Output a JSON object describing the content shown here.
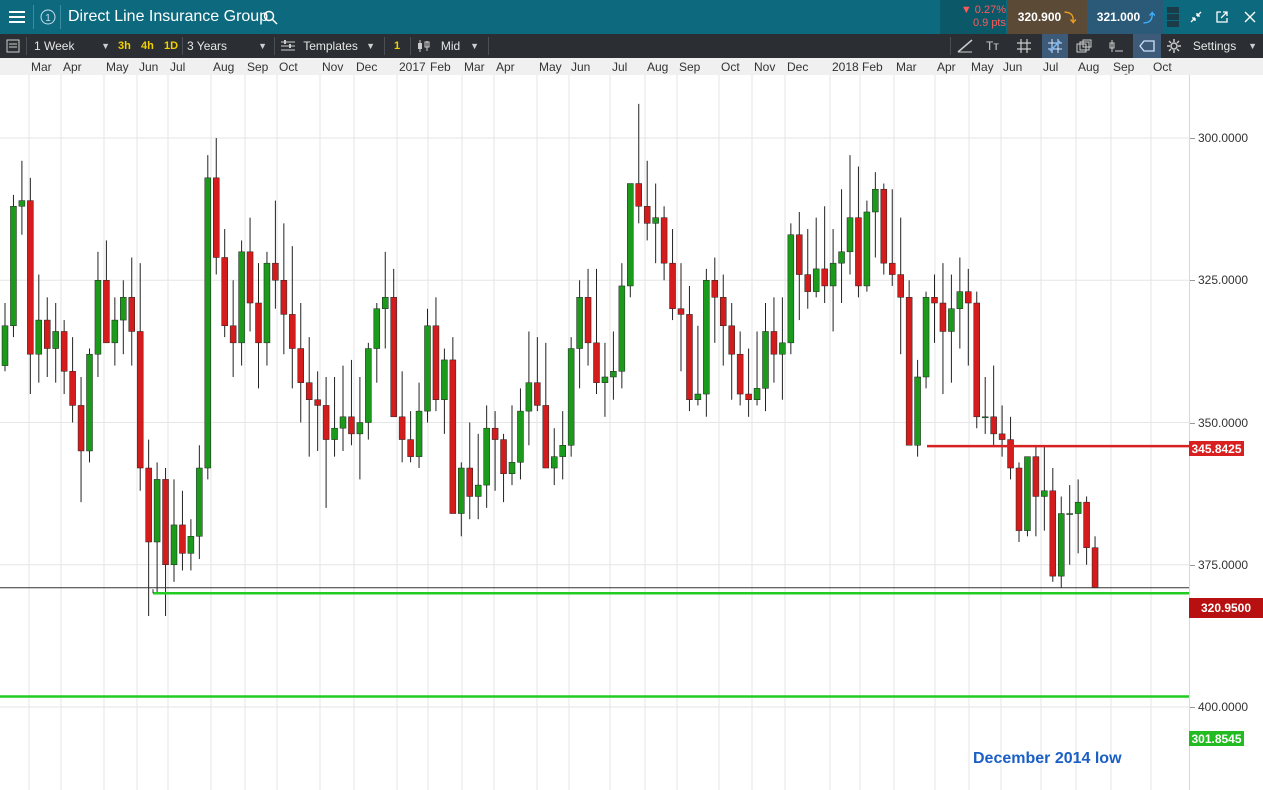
{
  "header": {
    "title": "Direct Line Insurance Group",
    "change_pct": "0.27%",
    "change_pts": "0.9 pts",
    "sell_price": "320.900",
    "buy_price": "321.000"
  },
  "toolbar": {
    "interval": "1 Week",
    "quick_3h": "3h",
    "quick_4h": "4h",
    "quick_1d": "1D",
    "range": "3 Years",
    "templates": "Templates",
    "count": "1",
    "price_type": "Mid",
    "settings": "Settings"
  },
  "colors": {
    "up": "#1b9a1b",
    "down": "#d41c1c",
    "header": "#0d6a7e",
    "toolbar": "#2b2f33",
    "support": "#22cc22",
    "resistance": "#d82020",
    "annotation": "#1a5fc4"
  },
  "axis": {
    "months": [
      "Mar",
      "Apr",
      "May",
      "Jun",
      "Jul",
      "Aug",
      "Sep",
      "Oct",
      "Nov",
      "Dec",
      "2017",
      "Feb",
      "Mar",
      "Apr",
      "May",
      "Jun",
      "Jul",
      "Aug",
      "Sep",
      "Oct",
      "Nov",
      "Dec",
      "2018",
      "Feb",
      "Mar",
      "Apr",
      "May",
      "Jun",
      "Jul",
      "Aug",
      "Sep",
      "Oct"
    ],
    "yticks": [
      "400.0000",
      "375.0000",
      "350.0000",
      "325.0000",
      "300.0000"
    ]
  },
  "levels": {
    "resistance": "345.8425",
    "current": "320.9500",
    "support": "301.8545"
  },
  "annotation": "December 2014 low",
  "chart_data": {
    "type": "candlestick",
    "interval": "1 Week",
    "range": "3 Years",
    "ylim": [
      298,
      412
    ],
    "yticks": [
      300,
      325,
      350,
      375,
      400
    ],
    "horizontal_lines": [
      {
        "value": 345.8425,
        "color": "#d82020",
        "label": "345.8425"
      },
      {
        "value": 320.95,
        "color": "#d41c1c",
        "label": "320.9500"
      },
      {
        "value": 320.0,
        "color": "#22cc22"
      },
      {
        "value": 301.8545,
        "color": "#22cc22",
        "label": "301.8545"
      }
    ],
    "ohlc": [
      [
        360,
        371,
        359,
        367
      ],
      [
        367,
        390,
        365,
        388
      ],
      [
        388,
        396,
        383,
        389
      ],
      [
        389,
        393,
        355,
        362
      ],
      [
        362,
        376,
        357,
        368
      ],
      [
        368,
        372,
        358,
        363
      ],
      [
        363,
        371,
        357,
        366
      ],
      [
        366,
        368,
        355,
        359
      ],
      [
        359,
        365,
        350,
        353
      ],
      [
        353,
        358,
        336,
        345
      ],
      [
        345,
        363,
        343,
        362
      ],
      [
        362,
        380,
        358,
        375
      ],
      [
        375,
        382,
        365,
        364
      ],
      [
        364,
        372,
        360,
        368
      ],
      [
        368,
        375,
        362,
        372
      ],
      [
        372,
        379,
        360,
        366
      ],
      [
        366,
        378,
        338,
        342
      ],
      [
        342,
        347,
        316,
        329
      ],
      [
        329,
        343,
        320,
        340
      ],
      [
        340,
        342,
        316,
        325
      ],
      [
        325,
        340,
        322,
        332
      ],
      [
        332,
        338,
        324,
        327
      ],
      [
        327,
        333,
        324,
        330
      ],
      [
        330,
        346,
        326,
        342
      ],
      [
        342,
        397,
        340,
        393
      ],
      [
        393,
        400,
        376,
        379
      ],
      [
        379,
        384,
        365,
        367
      ],
      [
        367,
        375,
        358,
        364
      ],
      [
        364,
        382,
        360,
        380
      ],
      [
        380,
        386,
        366,
        371
      ],
      [
        371,
        378,
        356,
        364
      ],
      [
        364,
        380,
        360,
        378
      ],
      [
        378,
        389,
        370,
        375
      ],
      [
        375,
        385,
        362,
        369
      ],
      [
        369,
        381,
        356,
        363
      ],
      [
        363,
        371,
        350,
        357
      ],
      [
        357,
        365,
        344,
        354
      ],
      [
        354,
        359,
        345,
        353
      ],
      [
        353,
        358,
        335,
        347
      ],
      [
        347,
        358,
        344,
        349
      ],
      [
        349,
        360,
        345,
        351
      ],
      [
        351,
        361,
        346,
        348
      ],
      [
        348,
        358,
        340,
        350
      ],
      [
        350,
        364,
        347,
        363
      ],
      [
        363,
        371,
        357,
        370
      ],
      [
        370,
        380,
        363,
        372
      ],
      [
        372,
        377,
        357,
        351
      ],
      [
        351,
        359,
        343,
        347
      ],
      [
        347,
        352,
        343,
        344
      ],
      [
        344,
        357,
        342,
        352
      ],
      [
        352,
        370,
        350,
        367
      ],
      [
        367,
        372,
        352,
        354
      ],
      [
        354,
        363,
        348,
        361
      ],
      [
        361,
        365,
        347,
        334
      ],
      [
        334,
        343,
        330,
        342
      ],
      [
        342,
        350,
        333,
        337
      ],
      [
        337,
        348,
        333,
        339
      ],
      [
        339,
        353,
        335,
        349
      ],
      [
        349,
        352,
        338,
        347
      ],
      [
        347,
        348,
        336,
        341
      ],
      [
        341,
        353,
        339,
        343
      ],
      [
        343,
        356,
        340,
        352
      ],
      [
        352,
        366,
        346,
        357
      ],
      [
        357,
        365,
        352,
        353
      ],
      [
        353,
        364,
        344,
        342
      ],
      [
        342,
        349,
        339,
        344
      ],
      [
        344,
        352,
        340,
        346
      ],
      [
        346,
        365,
        344,
        363
      ],
      [
        363,
        375,
        356,
        372
      ],
      [
        372,
        377,
        360,
        364
      ],
      [
        364,
        377,
        355,
        357
      ],
      [
        357,
        364,
        351,
        358
      ],
      [
        358,
        366,
        354,
        359
      ],
      [
        359,
        378,
        356,
        374
      ],
      [
        374,
        390,
        372,
        392
      ],
      [
        392,
        406,
        385,
        388
      ],
      [
        388,
        396,
        382,
        385
      ],
      [
        385,
        392,
        378,
        386
      ],
      [
        386,
        388,
        375,
        378
      ],
      [
        378,
        384,
        368,
        370
      ],
      [
        370,
        378,
        359,
        369
      ],
      [
        369,
        374,
        352,
        354
      ],
      [
        354,
        367,
        353,
        355
      ],
      [
        355,
        377,
        351,
        375
      ],
      [
        375,
        379,
        364,
        372
      ],
      [
        372,
        376,
        360,
        367
      ],
      [
        367,
        371,
        354,
        362
      ],
      [
        362,
        366,
        353,
        355
      ],
      [
        355,
        363,
        351,
        354
      ],
      [
        354,
        366,
        353,
        356
      ],
      [
        356,
        371,
        352,
        366
      ],
      [
        366,
        372,
        357,
        362
      ],
      [
        362,
        372,
        354,
        364
      ],
      [
        364,
        385,
        362,
        383
      ],
      [
        383,
        387,
        368,
        376
      ],
      [
        376,
        384,
        370,
        373
      ],
      [
        373,
        386,
        372,
        377
      ],
      [
        377,
        388,
        371,
        374
      ],
      [
        374,
        384,
        366,
        378
      ],
      [
        378,
        391,
        371,
        380
      ],
      [
        380,
        397,
        376,
        386
      ],
      [
        386,
        395,
        372,
        374
      ],
      [
        374,
        389,
        373,
        387
      ],
      [
        387,
        394,
        379,
        391
      ],
      [
        391,
        392,
        376,
        378
      ],
      [
        378,
        391,
        374,
        376
      ],
      [
        376,
        386,
        362,
        372
      ],
      [
        372,
        375,
        346,
        346
      ],
      [
        346,
        361,
        344,
        358
      ],
      [
        358,
        373,
        356,
        372
      ],
      [
        372,
        376,
        364,
        371
      ],
      [
        371,
        378,
        355,
        366
      ],
      [
        366,
        376,
        357,
        370
      ],
      [
        370,
        379,
        363,
        373
      ],
      [
        373,
        377,
        360,
        371
      ],
      [
        371,
        373,
        349,
        351
      ],
      [
        351,
        358,
        348,
        351
      ],
      [
        351,
        360,
        346,
        348
      ],
      [
        348,
        353,
        344,
        347
      ],
      [
        347,
        351,
        340,
        342
      ],
      [
        342,
        343,
        329,
        331
      ],
      [
        331,
        344,
        330,
        344
      ],
      [
        344,
        346,
        330,
        337
      ],
      [
        337,
        346,
        331,
        338
      ],
      [
        338,
        342,
        322,
        323
      ],
      [
        323,
        337,
        321,
        334
      ],
      [
        334,
        339,
        325,
        334
      ],
      [
        334,
        340,
        327,
        336
      ],
      [
        336,
        337,
        325,
        328
      ],
      [
        328,
        330,
        322,
        320.95
      ]
    ]
  }
}
